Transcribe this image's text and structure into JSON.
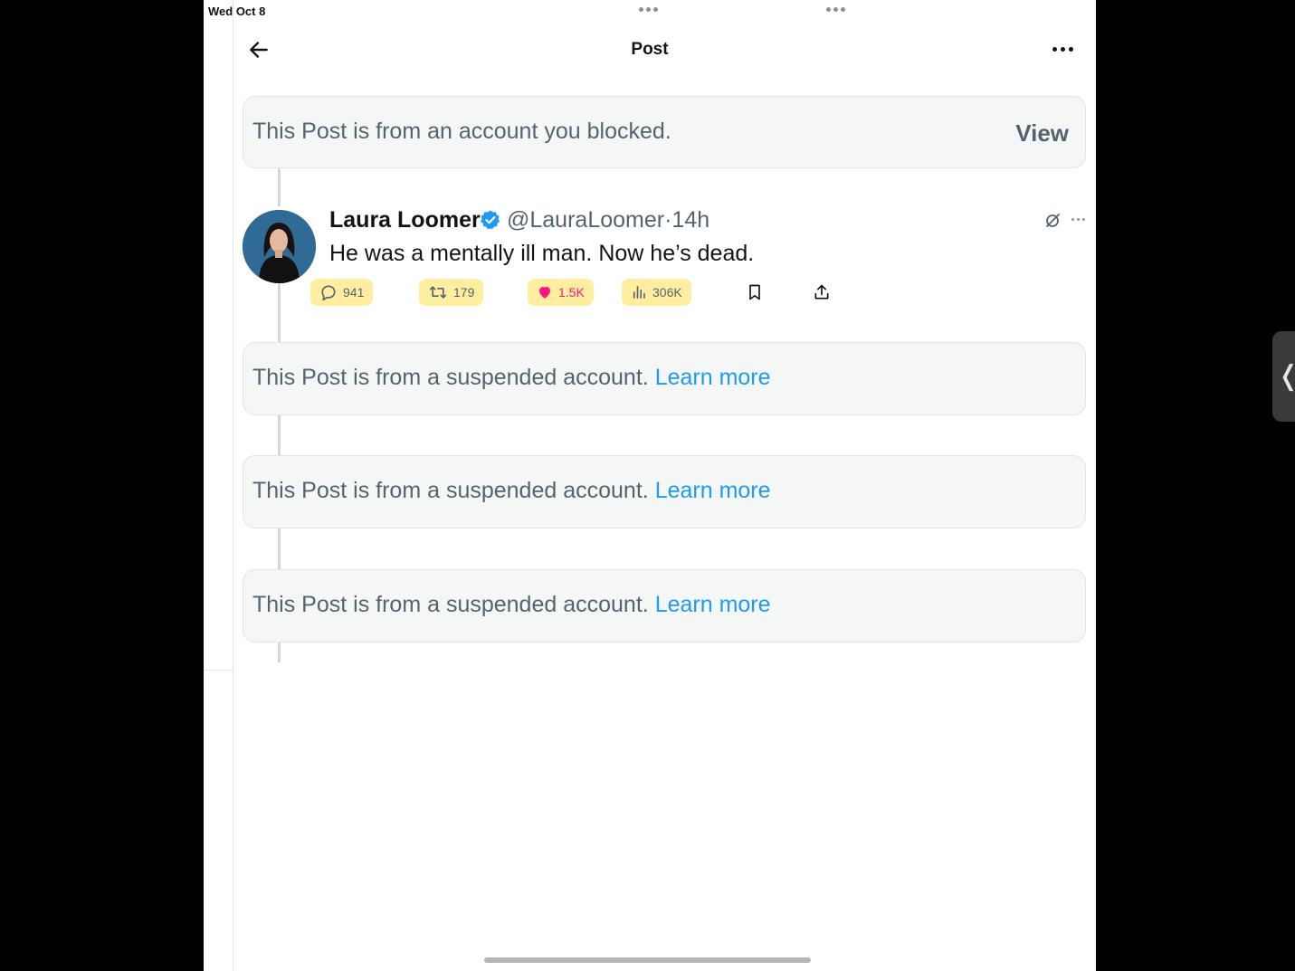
{
  "status_bar": {
    "date": "Wed Oct 8"
  },
  "header": {
    "title": "Post"
  },
  "blocked_notice": {
    "text": "This Post is from an account you blocked.",
    "view_label": "View"
  },
  "tweet": {
    "author_name": "Laura Loomer",
    "handle": "@LauraLoomer",
    "separator": "·",
    "time": "14h",
    "text": "He was a mentally ill man. Now he’s dead.",
    "stats": {
      "replies": "941",
      "reposts": "179",
      "likes": "1.5K",
      "views": "306K"
    }
  },
  "suspended_notices": [
    {
      "text": "This Post is from a suspended account.",
      "link": "Learn more"
    },
    {
      "text": "This Post is from a suspended account.",
      "link": "Learn more"
    },
    {
      "text": "This Post is from a suspended account.",
      "link": "Learn more"
    }
  ],
  "colors": {
    "accent": "#1d9bf0",
    "like": "#f91880",
    "highlight": "#ffe050",
    "muted_text": "#536471"
  },
  "icons": [
    "back-arrow-icon",
    "more-horizontal-icon",
    "verified-badge-icon",
    "grok-icon",
    "reply-icon",
    "repost-icon",
    "heart-icon",
    "views-chart-icon",
    "bookmark-icon",
    "share-icon",
    "sidebar-handle-chevron-icon"
  ]
}
